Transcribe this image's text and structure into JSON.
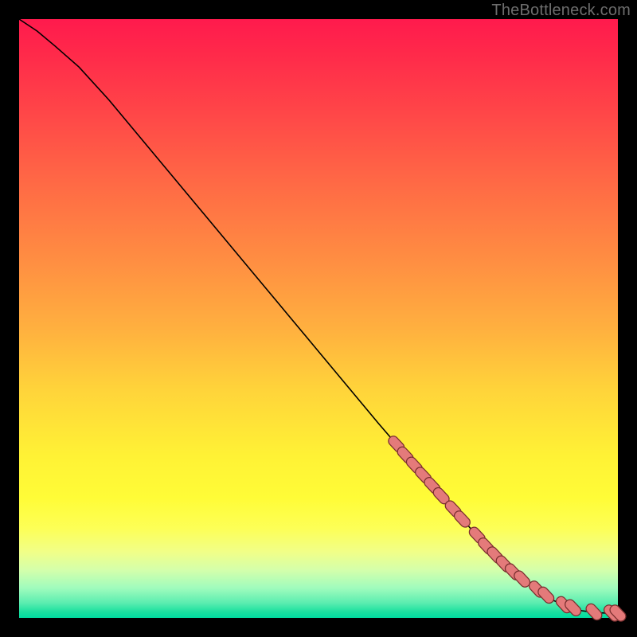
{
  "watermark": "TheBottleneck.com",
  "colors": {
    "frame": "#000000",
    "line": "#000000",
    "point_fill": "#e47a7a",
    "point_stroke": "#7a2f2f"
  },
  "chart_data": {
    "type": "line",
    "title": "",
    "xlabel": "",
    "ylabel": "",
    "xlim": [
      0,
      100
    ],
    "ylim": [
      0,
      100
    ],
    "grid": false,
    "legend": false,
    "series": [
      {
        "name": "curve",
        "x": [
          0,
          3,
          6,
          10,
          15,
          20,
          25,
          30,
          35,
          40,
          45,
          50,
          55,
          60,
          63,
          66,
          70,
          74,
          78,
          82,
          86,
          89,
          92,
          94,
          96,
          98,
          100
        ],
        "y": [
          100,
          98,
          95.5,
          92,
          86.5,
          80.5,
          74.5,
          68.5,
          62.5,
          56.5,
          50.5,
          44.5,
          38.5,
          32.5,
          29,
          25.5,
          21,
          16.5,
          12,
          8,
          5,
          3,
          1.8,
          1.2,
          0.9,
          0.8,
          0.8
        ]
      }
    ],
    "scatter_points": {
      "name": "markers",
      "x": [
        63.0,
        64.5,
        66.0,
        67.5,
        69.0,
        70.5,
        72.5,
        74.0,
        76.5,
        78.0,
        79.5,
        81.0,
        82.5,
        84.0,
        86.5,
        88.0,
        91.0,
        92.5,
        96.0,
        99.0,
        100.0
      ],
      "y": [
        29.0,
        27.2,
        25.5,
        23.8,
        22.1,
        20.4,
        18.2,
        16.5,
        13.8,
        12.0,
        10.5,
        9.0,
        7.7,
        6.5,
        4.8,
        3.8,
        2.2,
        1.7,
        1.0,
        0.8,
        0.8
      ]
    }
  }
}
